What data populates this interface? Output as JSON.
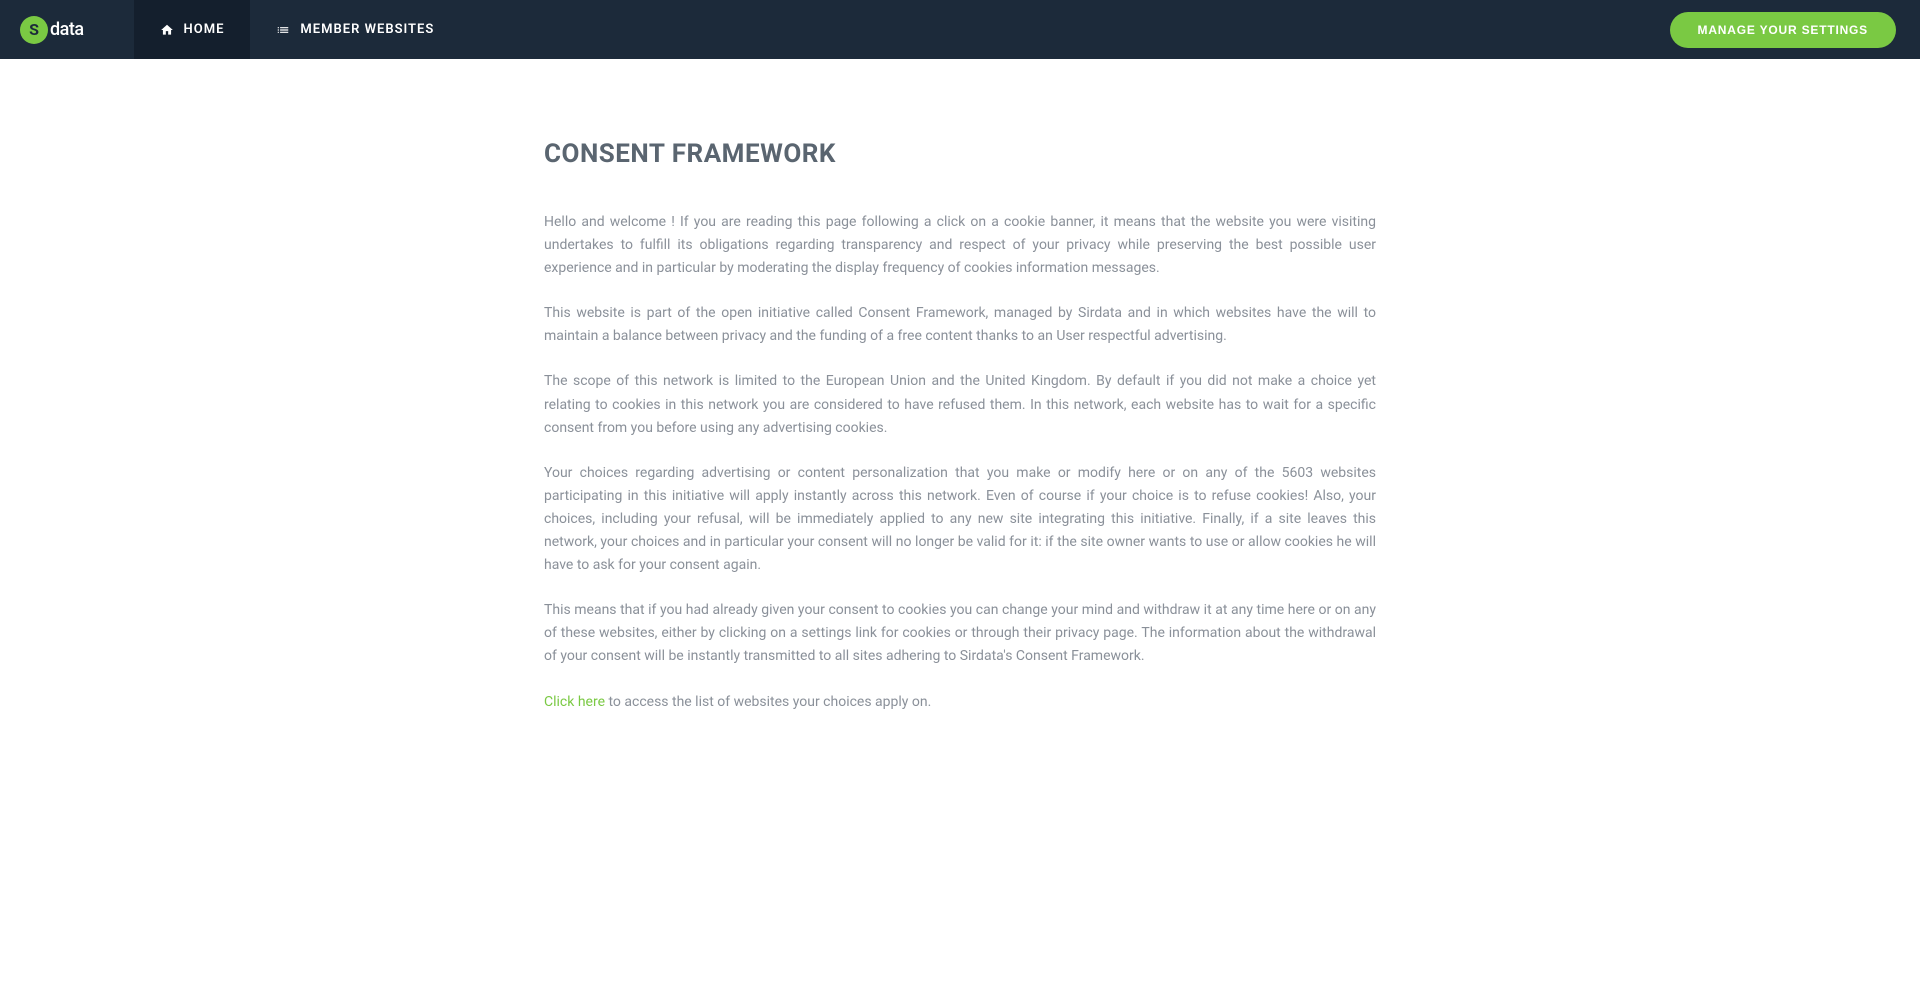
{
  "logo": {
    "text": "data",
    "inner": "S"
  },
  "nav": {
    "home": "HOME",
    "member_websites": "MEMBER WEBSITES"
  },
  "header": {
    "settings_button": "MANAGE YOUR SETTINGS"
  },
  "page": {
    "title": "CONSENT FRAMEWORK",
    "p1": "Hello and welcome ! If you are reading this page following a click on a cookie banner, it means that the website you were visiting undertakes to fulfill its obligations regarding transparency and respect of your privacy while preserving the best possible user experience and in particular by moderating the display frequency of cookies information messages.",
    "p2": "This website is part of the open initiative called Consent Framework, managed by Sirdata and in which websites have the will to maintain a balance between privacy and the funding of a free content thanks to an User respectful advertising.",
    "p3": "The scope of this network is limited to the European Union and the United Kingdom. By default if you did not make a choice yet relating to cookies in this network you are considered to have refused them. In this network, each website has to wait for a specific consent from you before using any advertising cookies.",
    "p4": "Your choices regarding advertising or content personalization that you make or modify here or on any of the 5603 websites participating in this initiative will apply instantly across this network. Even of course if your choice is to refuse cookies! Also, your choices, including your refusal, will be immediately applied to any new site integrating this initiative. Finally, if a site leaves this network, your choices and in particular your consent will no longer be valid for it: if the site owner wants to use or allow cookies he will have to ask for your consent again.",
    "p5": "This means that if you had already given your consent to cookies you can change your mind and withdraw it at any time here or on any of these websites, either by clicking on a settings link for cookies or through their privacy page. The information about the withdrawal of your consent will be instantly transmitted to all sites adhering to Sirdata's Consent Framework.",
    "p6_link": "Click here",
    "p6_rest": " to access the list of websites your choices apply on."
  }
}
